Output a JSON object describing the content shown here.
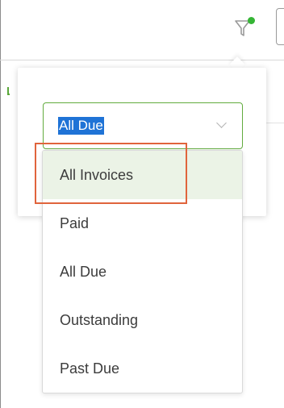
{
  "filter": {
    "icon": "funnel-icon",
    "active_indicator_color": "#35b535"
  },
  "dropdown": {
    "selected_value": "All Due",
    "accent_color": "#62ab3e",
    "options": [
      {
        "label": "All Invoices",
        "highlighted": true
      },
      {
        "label": "Paid",
        "highlighted": false
      },
      {
        "label": "All Due",
        "highlighted": false
      },
      {
        "label": "Outstanding",
        "highlighted": false
      },
      {
        "label": "Past Due",
        "highlighted": false
      }
    ]
  },
  "annotation": {
    "highlight_color": "#e0643c"
  }
}
